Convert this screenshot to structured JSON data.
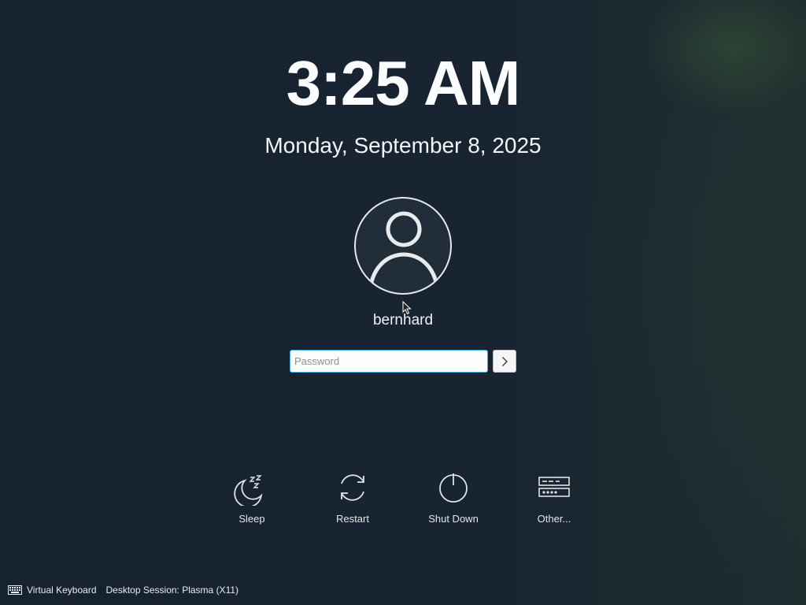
{
  "clock": {
    "time": "3:25 AM",
    "date": "Monday, September 8, 2025"
  },
  "user": {
    "name": "bernhard",
    "avatar_icon": "user-icon"
  },
  "login": {
    "password_placeholder": "Password",
    "submit_icon": "chevron-right-icon"
  },
  "actions": [
    {
      "label": "Sleep",
      "icon": "sleep-icon"
    },
    {
      "label": "Restart",
      "icon": "restart-icon"
    },
    {
      "label": "Shut Down",
      "icon": "power-icon"
    },
    {
      "label": "Other...",
      "icon": "switch-user-icon"
    }
  ],
  "footer": {
    "virtual_keyboard": "Virtual Keyboard",
    "keyboard_icon": "keyboard-icon",
    "session": "Desktop Session: Plasma (X11)"
  },
  "colors": {
    "background": "#17222f",
    "accent": "#3daee9",
    "text": "#eceff1"
  }
}
